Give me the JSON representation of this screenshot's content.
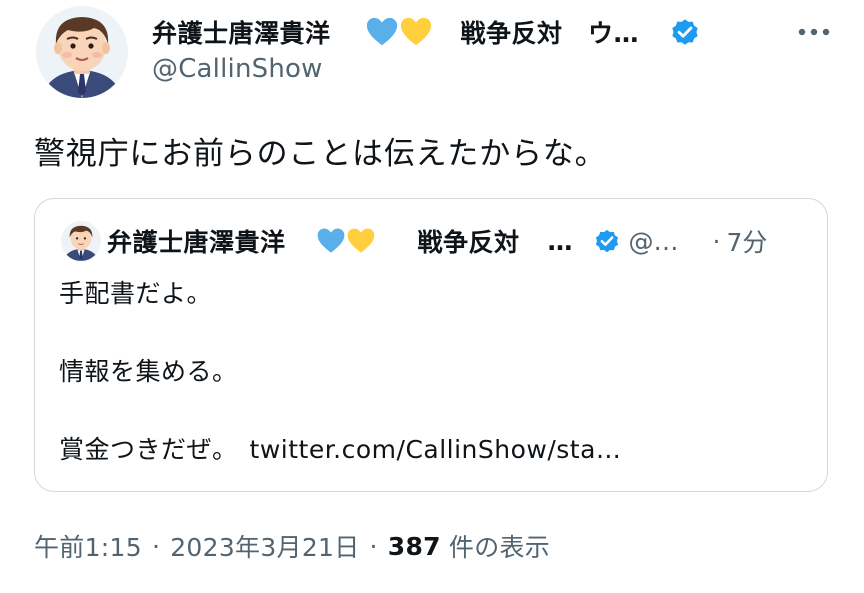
{
  "author": {
    "display_name": "弁護士唐澤貴洋",
    "name_suffix": "戦争反対　ウ…",
    "handle": "@CallinShow"
  },
  "icons": {
    "hearts": [
      "blue-heart-icon",
      "yellow-heart-icon"
    ],
    "verified": "verified-badge-icon",
    "more": "more-options-icon"
  },
  "colors": {
    "blue_heart": "#5aaeea",
    "yellow_heart": "#ffcf3d",
    "verified": "#1d9bf0",
    "secondary_text": "#536471",
    "border": "#cfd9de"
  },
  "tweet": {
    "text": "警視庁にお前らのことは伝えたからな。"
  },
  "quoted": {
    "display_name": "弁護士唐澤貴洋",
    "name_suffix": "戦争反対",
    "ellipsis": "…",
    "handle": "@…",
    "dot": "·",
    "time": "7分",
    "lines": {
      "l1": "手配書だよ。",
      "l2": "情報を集める。",
      "l3": "賞金つきだぜ。",
      "link": "twitter.com/CallinShow/sta…"
    }
  },
  "meta": {
    "time": "午前1:15",
    "sep": "·",
    "date": "2023年3月21日",
    "views_count": "387",
    "views_label": "件の表示"
  }
}
